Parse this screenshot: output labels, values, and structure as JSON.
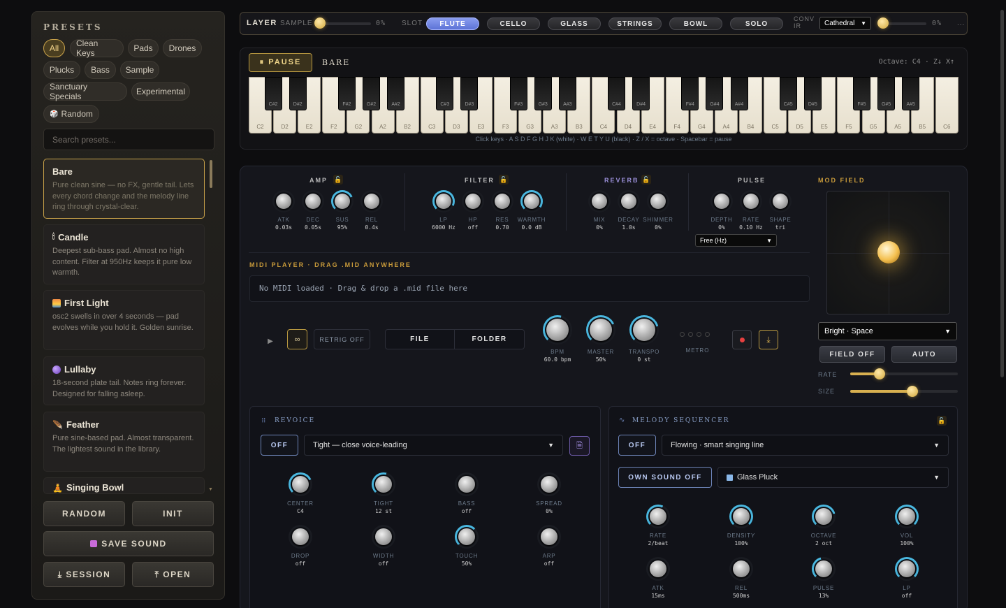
{
  "sidebar": {
    "title": "PRESETS",
    "chips": [
      {
        "label": "All",
        "active": true
      },
      {
        "label": "Clean Keys"
      },
      {
        "label": "Pads"
      },
      {
        "label": "Drones"
      },
      {
        "label": "Plucks"
      },
      {
        "label": "Bass"
      },
      {
        "label": "Sample"
      },
      {
        "label": "Sanctuary Specials"
      },
      {
        "label": "Experimental"
      },
      {
        "label": "Random",
        "icon": "dice-icon"
      }
    ],
    "search_placeholder": "Search presets...",
    "presets": [
      {
        "name": "Bare",
        "desc": "Pure clean sine — no FX, gentle tail. Lets every chord change and the melody line ring through crystal-clear.",
        "selected": true
      },
      {
        "name": "Candle",
        "icon": "candle-icon",
        "desc": "Deepest sub-bass pad. Almost no high content. Filter at 950Hz keeps it pure low warmth."
      },
      {
        "name": "First Light",
        "icon": "sunrise-icon",
        "desc": "osc2 swells in over 4 seconds — pad evolves while you hold it. Golden sunrise."
      },
      {
        "name": "Lullaby",
        "icon": "moon-icon",
        "desc": "18-second plate tail. Notes ring forever. Designed for falling asleep."
      },
      {
        "name": "Feather",
        "icon": "feather-icon",
        "desc": "Pure sine-based pad. Almost transparent. The lightest sound in the library."
      },
      {
        "name": "Singing Bowl",
        "icon": "bowl-icon",
        "desc": ""
      }
    ],
    "buttons": {
      "random": "RANDOM",
      "init": "INIT",
      "save": "SAVE SOUND",
      "session": "⤓ SESSION",
      "open": "⤒ OPEN"
    }
  },
  "topbar": {
    "layer_label": "LAYER",
    "sample_label": "SAMPLE",
    "sample_value": "0%",
    "sample_level": 0,
    "slot_label": "SLOT",
    "slots": [
      {
        "label": "FLUTE",
        "active": true
      },
      {
        "label": "CELLO"
      },
      {
        "label": "GLASS"
      },
      {
        "label": "STRINGS"
      },
      {
        "label": "BOWL"
      },
      {
        "label": "SOLO"
      }
    ],
    "conv_label": "CONV IR",
    "conv_select": "Cathedral",
    "conv_value": "0%",
    "conv_level": 0,
    "more": "..."
  },
  "keyboard": {
    "pause_label": "⏸ PAUSE",
    "preset_name": "BARE",
    "octave_info": "Octave: C4 · Z↓ X↑",
    "hint": "Click keys · A S D F G H J K (white) · W E T Y U (black) · Z / X = octave · Spacebar = pause",
    "white_keys": [
      "C2",
      "D2",
      "E2",
      "F2",
      "G2",
      "A2",
      "B2",
      "C3",
      "D3",
      "E3",
      "F3",
      "G3",
      "A3",
      "B3",
      "C4",
      "D4",
      "E4",
      "F4",
      "G4",
      "A4",
      "B4",
      "C5",
      "D5",
      "E5",
      "F5",
      "G5",
      "A5",
      "B5",
      "C6"
    ],
    "black_keys": [
      "C#2",
      "D#2",
      "F#2",
      "G#2",
      "A#2",
      "C#3",
      "D#3",
      "F#3",
      "G#3",
      "A#3",
      "C#4",
      "D#4",
      "F#4",
      "G#4",
      "A#4",
      "C#5",
      "D#5",
      "F#5",
      "G#5",
      "A#5"
    ]
  },
  "synth": {
    "amp": {
      "title": "AMP",
      "knobs": [
        {
          "label": "ATK",
          "value": "0.03s"
        },
        {
          "label": "DEC",
          "value": "0.05s"
        },
        {
          "label": "SUS",
          "value": "95%"
        },
        {
          "label": "REL",
          "value": "0.4s"
        }
      ]
    },
    "filter": {
      "title": "FILTER",
      "knobs": [
        {
          "label": "LP",
          "value": "6000 Hz"
        },
        {
          "label": "HP",
          "value": "off"
        },
        {
          "label": "RES",
          "value": "0.70"
        },
        {
          "label": "WARMTH",
          "value": "0.0 dB"
        }
      ]
    },
    "reverb": {
      "title": "REVERB",
      "knobs": [
        {
          "label": "MIX",
          "value": "0%"
        },
        {
          "label": "DECAY",
          "value": "1.0s"
        },
        {
          "label": "SHIMMER",
          "value": "0%"
        }
      ]
    },
    "pulse": {
      "title": "PULSE",
      "knobs": [
        {
          "label": "DEPTH",
          "value": "0%"
        },
        {
          "label": "RATE",
          "value": "0.10 Hz"
        },
        {
          "label": "SHAPE",
          "value": "tri"
        }
      ],
      "mode": "Free (Hz)"
    },
    "modfield": {
      "title": "MOD FIELD",
      "select": "Bright · Space",
      "field_off": "FIELD OFF",
      "auto": "AUTO",
      "rate_label": "RATE",
      "size_label": "SIZE",
      "rate_level": 0.27,
      "size_level": 0.58
    }
  },
  "midi": {
    "title": "MIDI PLAYER · DRAG .MID ANYWHERE",
    "drop_text": "No MIDI loaded · Drag & drop a .mid file here",
    "retrig": "RETRIG OFF",
    "file": "FILE",
    "folder": "FOLDER",
    "knobs": [
      {
        "label": "BPM",
        "value": "60.0 bpm"
      },
      {
        "label": "MASTER",
        "value": "50%"
      },
      {
        "label": "TRANSPO",
        "value": "0 st"
      }
    ],
    "metro": "METRO"
  },
  "revoice": {
    "title": "REVOICE",
    "toggle": "OFF",
    "mode": "Tight — close voice-leading",
    "knobs": [
      {
        "label": "CENTER",
        "value": "C4"
      },
      {
        "label": "TIGHT",
        "value": "12 st"
      },
      {
        "label": "BASS",
        "value": "off"
      },
      {
        "label": "SPREAD",
        "value": "0%"
      },
      {
        "label": "DROP",
        "value": "off"
      },
      {
        "label": "WIDTH",
        "value": "off"
      },
      {
        "label": "TOUCH",
        "value": "50%"
      },
      {
        "label": "ARP",
        "value": "off"
      }
    ]
  },
  "melody": {
    "title": "MELODY SEQUENCER",
    "toggle": "OFF",
    "mode": "Flowing · smart singing line",
    "own_sound": "OWN SOUND OFF",
    "sound": "Glass Pluck",
    "knobs": [
      {
        "label": "RATE",
        "value": "2/beat"
      },
      {
        "label": "DENSITY",
        "value": "100%"
      },
      {
        "label": "OCTAVE",
        "value": "2 oct"
      },
      {
        "label": "VOL",
        "value": "100%"
      },
      {
        "label": "ATK",
        "value": "15ms"
      },
      {
        "label": "REL",
        "value": "500ms"
      },
      {
        "label": "PULSE",
        "value": "13%"
      },
      {
        "label": "LP",
        "value": "off"
      }
    ]
  }
}
